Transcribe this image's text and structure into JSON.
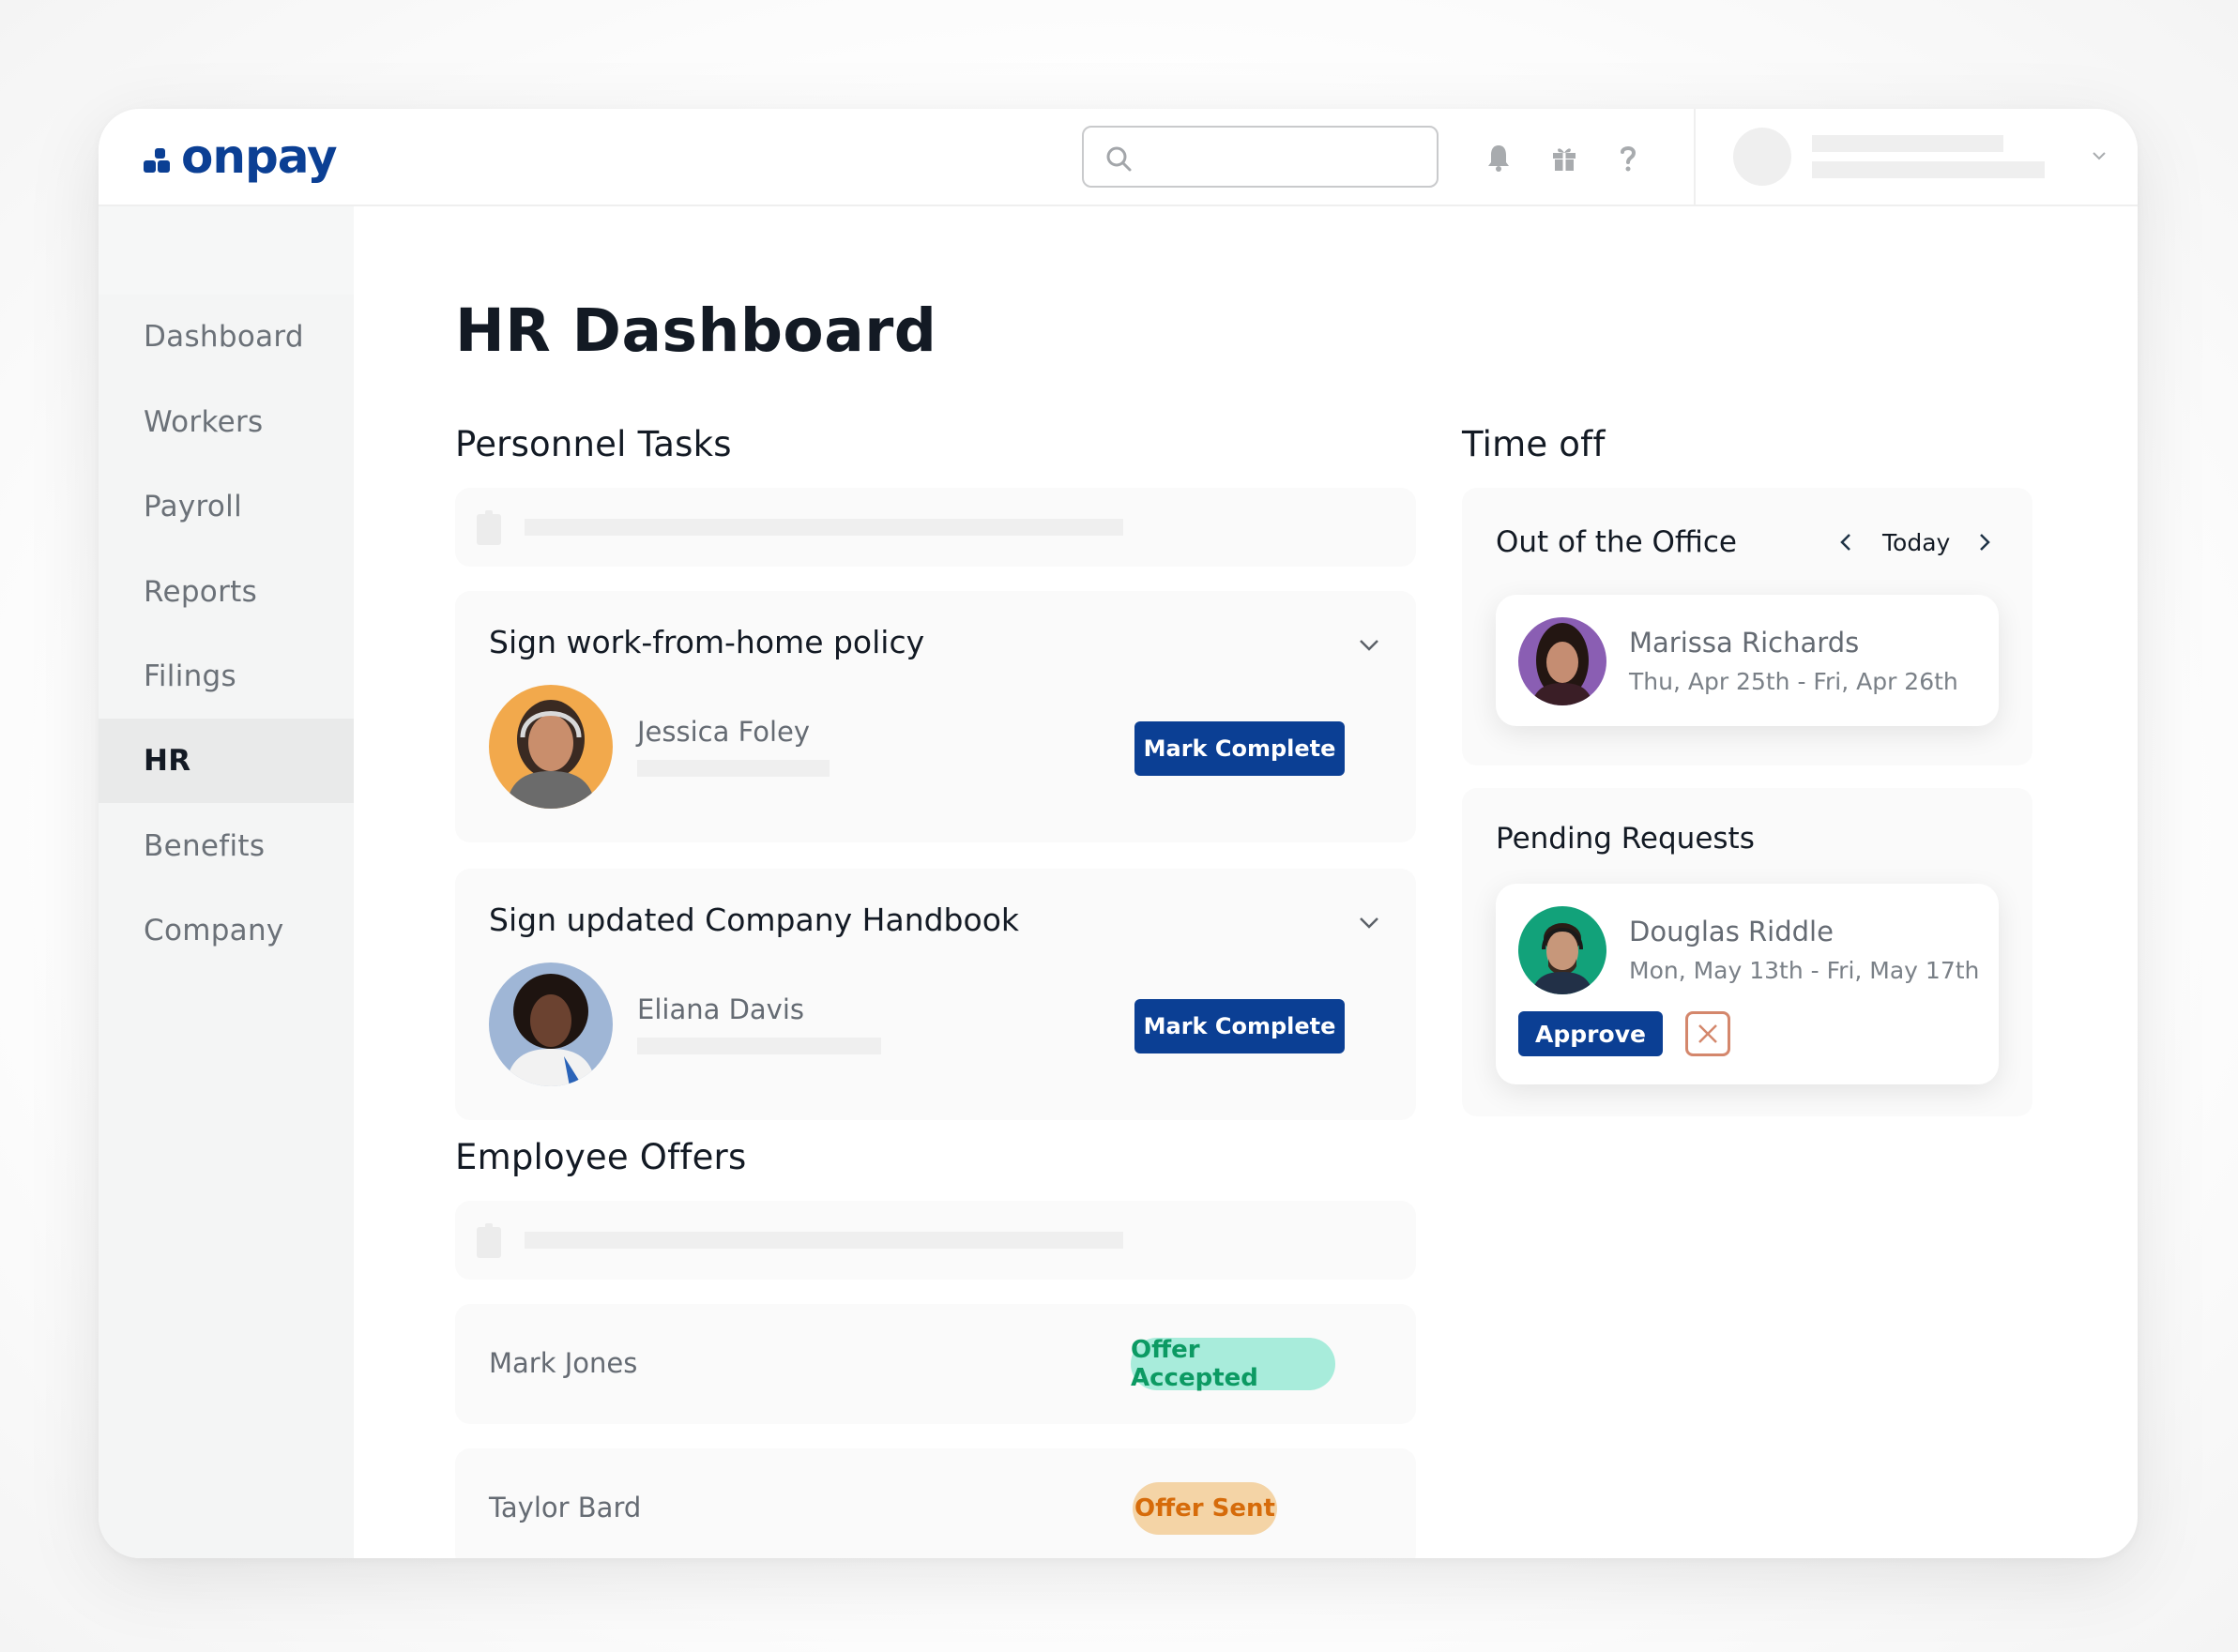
{
  "brand": {
    "name": "onpay",
    "color": "#0b3f94"
  },
  "header": {
    "search_placeholder": "",
    "icons": [
      "bell-icon",
      "gift-icon",
      "help-icon"
    ]
  },
  "sidebar": {
    "items": [
      {
        "label": "Dashboard",
        "active": false
      },
      {
        "label": "Workers",
        "active": false
      },
      {
        "label": "Payroll",
        "active": false
      },
      {
        "label": "Reports",
        "active": false
      },
      {
        "label": "Filings",
        "active": false
      },
      {
        "label": "HR",
        "active": true
      },
      {
        "label": "Benefits",
        "active": false
      },
      {
        "label": "Company",
        "active": false
      }
    ]
  },
  "main": {
    "title": "HR Dashboard",
    "personnel_tasks": {
      "title": "Personnel Tasks",
      "tasks": [
        {
          "title": "Sign work-from-home policy",
          "person": "Jessica Foley",
          "action": "Mark Complete",
          "avatar_bg": "#f2a94c"
        },
        {
          "title": "Sign updated Company Handbook",
          "person": "Eliana Davis",
          "action": "Mark Complete",
          "avatar_bg": "#9fb6d6"
        }
      ]
    },
    "employee_offers": {
      "title": "Employee Offers",
      "offers": [
        {
          "name": "Mark Jones",
          "status": "Offer Accepted",
          "status_bg": "#a8ecdb",
          "status_color": "#0c9a63"
        },
        {
          "name": "Taylor Bard",
          "status": "Offer Sent",
          "status_bg": "#f4d4a6",
          "status_color": "#d66b0a"
        }
      ]
    },
    "time_off": {
      "title": "Time off",
      "out_of_office": {
        "title": "Out of the Office",
        "nav_label": "Today",
        "person": "Marissa Richards",
        "dates": "Thu, Apr 25th - Fri, Apr 26th",
        "avatar_bg": "#8a5eb3"
      },
      "pending_requests": {
        "title": "Pending Requests",
        "person": "Douglas Riddle",
        "dates": "Mon, May 13th - Fri, May 17th",
        "approve_label": "Approve",
        "avatar_bg": "#12a27a"
      }
    }
  }
}
